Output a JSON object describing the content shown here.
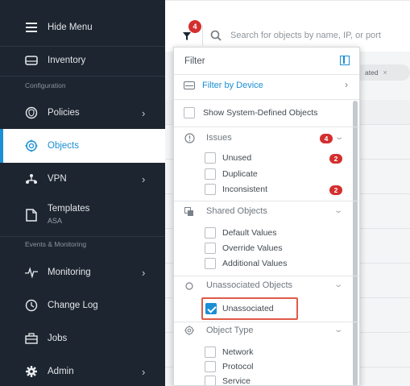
{
  "sidebar": {
    "hide_menu": "Hide Menu",
    "inventory": "Inventory",
    "section_configuration": "Configuration",
    "policies": "Policies",
    "objects": "Objects",
    "vpn": "VPN",
    "templates": "Templates",
    "templates_sub": "ASA",
    "section_events": "Events & Monitoring",
    "monitoring": "Monitoring",
    "change_log": "Change Log",
    "jobs": "Jobs",
    "admin": "Admin"
  },
  "toolbar": {
    "filter_count": "4",
    "search_placeholder": "Search for objects by name, IP, or port",
    "chip_label": "ated",
    "chip_close": "×"
  },
  "filter_panel": {
    "title": "Filter",
    "filter_by_device": "Filter by Device",
    "show_system_defined": "Show System-Defined Objects",
    "issues": {
      "label": "Issues",
      "count": "4",
      "options": [
        {
          "label": "Unused",
          "count": "2"
        },
        {
          "label": "Duplicate",
          "count": ""
        },
        {
          "label": "Inconsistent",
          "count": "2"
        }
      ]
    },
    "shared": {
      "label": "Shared Objects",
      "options": [
        {
          "label": "Default Values"
        },
        {
          "label": "Override Values"
        },
        {
          "label": "Additional Values"
        }
      ]
    },
    "unassociated": {
      "label": "Unassociated Objects",
      "option": {
        "label": "Unassociated",
        "checked": true
      }
    },
    "object_type": {
      "label": "Object Type",
      "options": [
        {
          "label": "Network"
        },
        {
          "label": "Protocol"
        },
        {
          "label": "Service"
        }
      ]
    }
  },
  "colors": {
    "accent": "#1a8fd6",
    "sidebar_bg": "#1d2530",
    "badge_red": "#d32f2f",
    "highlight": "#e05a4a"
  }
}
